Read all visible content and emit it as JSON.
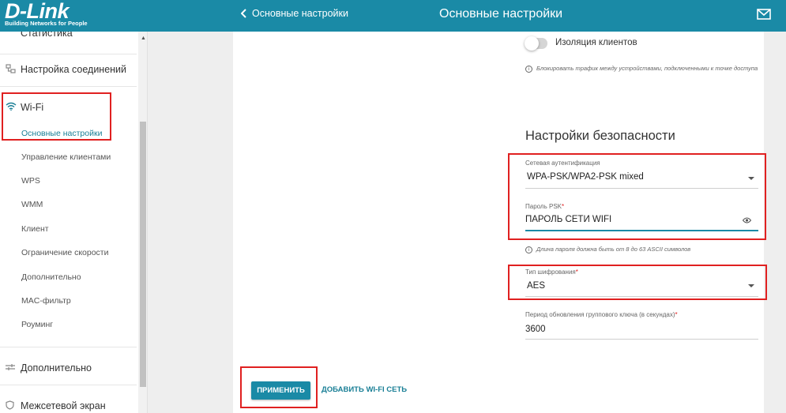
{
  "header": {
    "logo_brand": "D-Link",
    "logo_tagline": "Building Networks for People",
    "back_label": "Основные настройки",
    "title": "Основные настройки"
  },
  "sidebar": {
    "top_item": "Статистика",
    "items": [
      {
        "label": "Настройка соединений",
        "icon": "network-icon"
      },
      {
        "label": "Wi-Fi",
        "icon": "wifi-icon"
      },
      {
        "label": "Дополнительно",
        "icon": "sliders-icon"
      },
      {
        "label": "Межсетевой экран",
        "icon": "shield-icon"
      }
    ],
    "wifi_subitems": [
      "Основные настройки",
      "Управление клиентами",
      "WPS",
      "WMM",
      "Клиент",
      "Ограничение скорости",
      "Дополнительно",
      "MAC-фильтр",
      "Роуминг"
    ],
    "active_subitem": "Основные настройки"
  },
  "main": {
    "client_isolation": {
      "label": "Изоляция клиентов",
      "enabled": false,
      "hint": "Блокировать трафик между устройствами, подключенными к точке доступа"
    },
    "security_title": "Настройки безопасности",
    "auth": {
      "label": "Сетевая аутентификация",
      "value": "WPA-PSK/WPA2-PSK mixed"
    },
    "psk": {
      "label": "Пароль PSK",
      "required_mark": "*",
      "value": "ПАРОЛЬ СЕТИ WIFI",
      "hint": "Длина пароля должна быть от 8 до 63 ASCII символов"
    },
    "encryption": {
      "label": "Тип шифрования",
      "required_mark": "*",
      "value": "AES"
    },
    "group_key": {
      "label": "Период обновления группового ключа (в секундах)",
      "required_mark": "*",
      "value": "3600"
    },
    "apply_button": "ПРИМЕНИТЬ",
    "add_wifi_link": "ДОБАВИТЬ WI-FI СЕТЬ"
  },
  "colors": {
    "accent": "#1a8aa6",
    "highlight_box": "#e02020"
  }
}
